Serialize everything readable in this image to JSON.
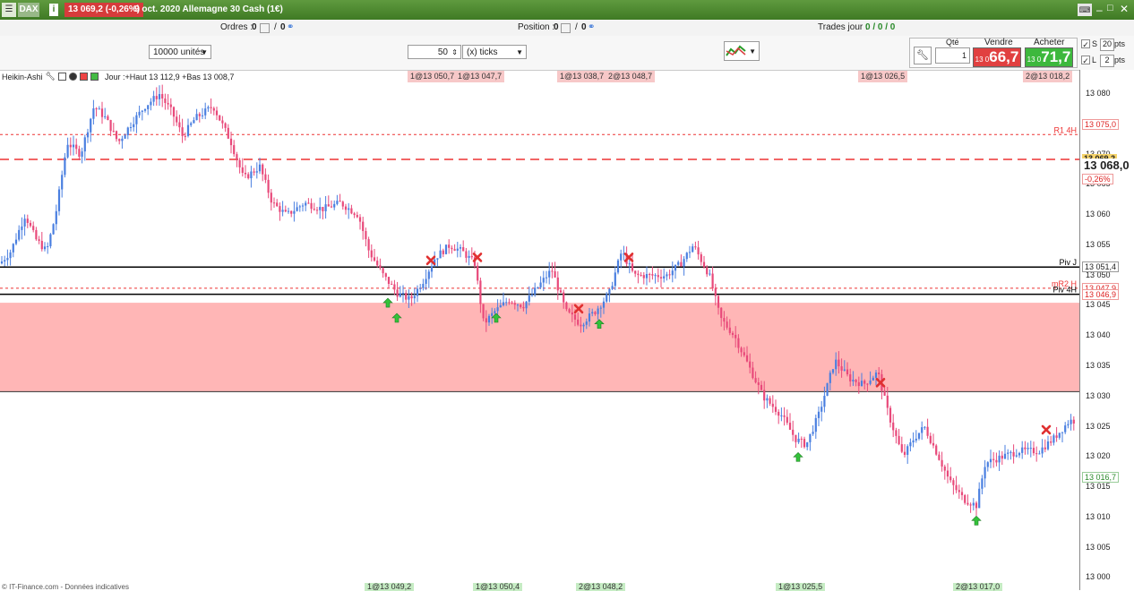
{
  "titlebar": {
    "symbol": "DAX",
    "price_badge": "13 069,2 (-0,26%)",
    "info_icon": "info-icon",
    "description": "9 oct. 2020 Allemagne 30 Cash (1€)"
  },
  "toolbar": {
    "orders_label": "Ordres :",
    "orders_count": "0",
    "orders_count2": "0",
    "position_label": "Position :",
    "position_count": "0",
    "position_count2": "0",
    "trades_label": "Trades jour :",
    "trades_values": "0 / 0 / 0",
    "units_select": "10000 unités",
    "ticks_value": "50",
    "ticks_select": "(x) ticks"
  },
  "trade_panel": {
    "qty_label": "Qté",
    "qty_value": "1",
    "sell_label": "Vendre",
    "buy_label": "Acheter",
    "sell_prefix": "13 0",
    "sell_price": "66,7",
    "buy_prefix": "13 0",
    "buy_price": "71,7",
    "s_label": "S",
    "s_value": "20",
    "l_label": "L",
    "l_value": "2",
    "pts": "pts",
    "colors": {
      "sell": "#e14040",
      "buy": "#3db83d"
    }
  },
  "chart_header": {
    "type": "Heikin-Ashi",
    "range": "Jour :+Haut 13 112,9 +Bas 13 008,7"
  },
  "header_trades": [
    "1@13 050,7",
    "1@13 047,7",
    "1@13 038,7",
    "2@13 048,7",
    "1@13 026,5",
    "2@13 018,2"
  ],
  "footer_trades": [
    "1@13 049,2",
    "1@13 050,4",
    "2@13 048,2",
    "1@13 025,5",
    "2@13 017,0"
  ],
  "footer_note": "© IT-Finance.com - Données indicatives",
  "chart_data": {
    "type": "candlestick",
    "title": "",
    "ylim": [
      12998,
      13084
    ],
    "yticks": [
      "13 080",
      "13 075",
      "13 070",
      "13 065",
      "13 060",
      "13 055",
      "13 050",
      "13 045",
      "13 040",
      "13 035",
      "13 030",
      "13 025",
      "13 020",
      "13 015",
      "13 010",
      "13 005",
      "13 000"
    ],
    "colors": {
      "up": "#4a7fe0",
      "down": "#e8497a",
      "zone": "#ffb6b6"
    },
    "levels": [
      {
        "name": "R1 4H",
        "value": 13073.3,
        "style": "dotted",
        "color": "#e33"
      },
      {
        "name": "",
        "value": 13069.2,
        "style": "dashed",
        "color": "#e33"
      },
      {
        "name": "Piv J",
        "value": 13051.4,
        "style": "solid",
        "color": "#000"
      },
      {
        "name": "mR2 H",
        "value": 13047.9,
        "style": "dotted",
        "color": "#e33"
      },
      {
        "name": "Piv 4H",
        "value": 13046.9,
        "style": "solid",
        "color": "#000"
      }
    ],
    "zone": [
      13030.8,
      13045.5
    ],
    "axis_tags": [
      {
        "text": "13 075,0",
        "value": 13075.0,
        "kind": "red"
      },
      {
        "text": "13 069,2",
        "value": 13069.2,
        "kind": "yellow"
      },
      {
        "text": "13 068,0",
        "value": 13068.0,
        "kind": "bold"
      },
      {
        "text": "-0,26%",
        "value": 13066.0,
        "kind": "red"
      },
      {
        "text": "13 051,4",
        "value": 13051.4,
        "kind": "plain"
      },
      {
        "text": "13 047,9",
        "value": 13047.9,
        "kind": "red"
      },
      {
        "text": "13 046,9",
        "value": 13046.9,
        "kind": "red"
      },
      {
        "text": "13 016,7",
        "value": 13016.7,
        "kind": "green"
      }
    ],
    "buy_markers": [
      13045.5,
      13043.0,
      13043.0,
      13042.0,
      13020.0,
      13009.5
    ],
    "sell_markers": [
      13052.5,
      13053.0,
      13044.5,
      13053.0,
      13032.3,
      13024.5
    ],
    "path": [
      [
        0,
        13052
      ],
      [
        12,
        13054
      ],
      [
        28,
        13060
      ],
      [
        40,
        13056
      ],
      [
        52,
        13054
      ],
      [
        62,
        13060
      ],
      [
        75,
        13072
      ],
      [
        90,
        13070
      ],
      [
        105,
        13078
      ],
      [
        118,
        13076
      ],
      [
        132,
        13072
      ],
      [
        146,
        13075
      ],
      [
        162,
        13078
      ],
      [
        178,
        13080
      ],
      [
        192,
        13077
      ],
      [
        204,
        13073
      ],
      [
        218,
        13076
      ],
      [
        238,
        13078
      ],
      [
        258,
        13072
      ],
      [
        272,
        13066
      ],
      [
        290,
        13068
      ],
      [
        304,
        13062
      ],
      [
        320,
        13060
      ],
      [
        340,
        13062
      ],
      [
        360,
        13061
      ],
      [
        380,
        13062
      ],
      [
        400,
        13060
      ],
      [
        412,
        13054
      ],
      [
        428,
        13050
      ],
      [
        444,
        13047
      ],
      [
        458,
        13046
      ],
      [
        472,
        13049
      ],
      [
        486,
        13053
      ],
      [
        502,
        13055
      ],
      [
        516,
        13054
      ],
      [
        530,
        13052
      ],
      [
        540,
        13042
      ],
      [
        552,
        13044
      ],
      [
        568,
        13046
      ],
      [
        584,
        13045
      ],
      [
        600,
        13048
      ],
      [
        616,
        13051
      ],
      [
        632,
        13044
      ],
      [
        648,
        13042
      ],
      [
        664,
        13044
      ],
      [
        680,
        13047
      ],
      [
        694,
        13054
      ],
      [
        708,
        13050
      ],
      [
        724,
        13050
      ],
      [
        744,
        13050
      ],
      [
        760,
        13052
      ],
      [
        774,
        13055
      ],
      [
        792,
        13050
      ],
      [
        804,
        13043
      ],
      [
        820,
        13040
      ],
      [
        836,
        13035
      ],
      [
        852,
        13030
      ],
      [
        872,
        13027
      ],
      [
        888,
        13023
      ],
      [
        900,
        13022
      ],
      [
        914,
        13027
      ],
      [
        932,
        13036
      ],
      [
        948,
        13033
      ],
      [
        964,
        13032
      ],
      [
        980,
        13034
      ],
      [
        992,
        13027
      ],
      [
        1008,
        13020
      ],
      [
        1020,
        13023
      ],
      [
        1032,
        13025
      ],
      [
        1048,
        13020
      ],
      [
        1060,
        13016
      ],
      [
        1076,
        13013
      ],
      [
        1090,
        13012
      ],
      [
        1100,
        13019
      ],
      [
        1118,
        13020
      ],
      [
        1138,
        13021
      ],
      [
        1160,
        13021
      ],
      [
        1176,
        13023
      ],
      [
        1194,
        13026
      ],
      [
        1203,
        13026
      ]
    ]
  }
}
